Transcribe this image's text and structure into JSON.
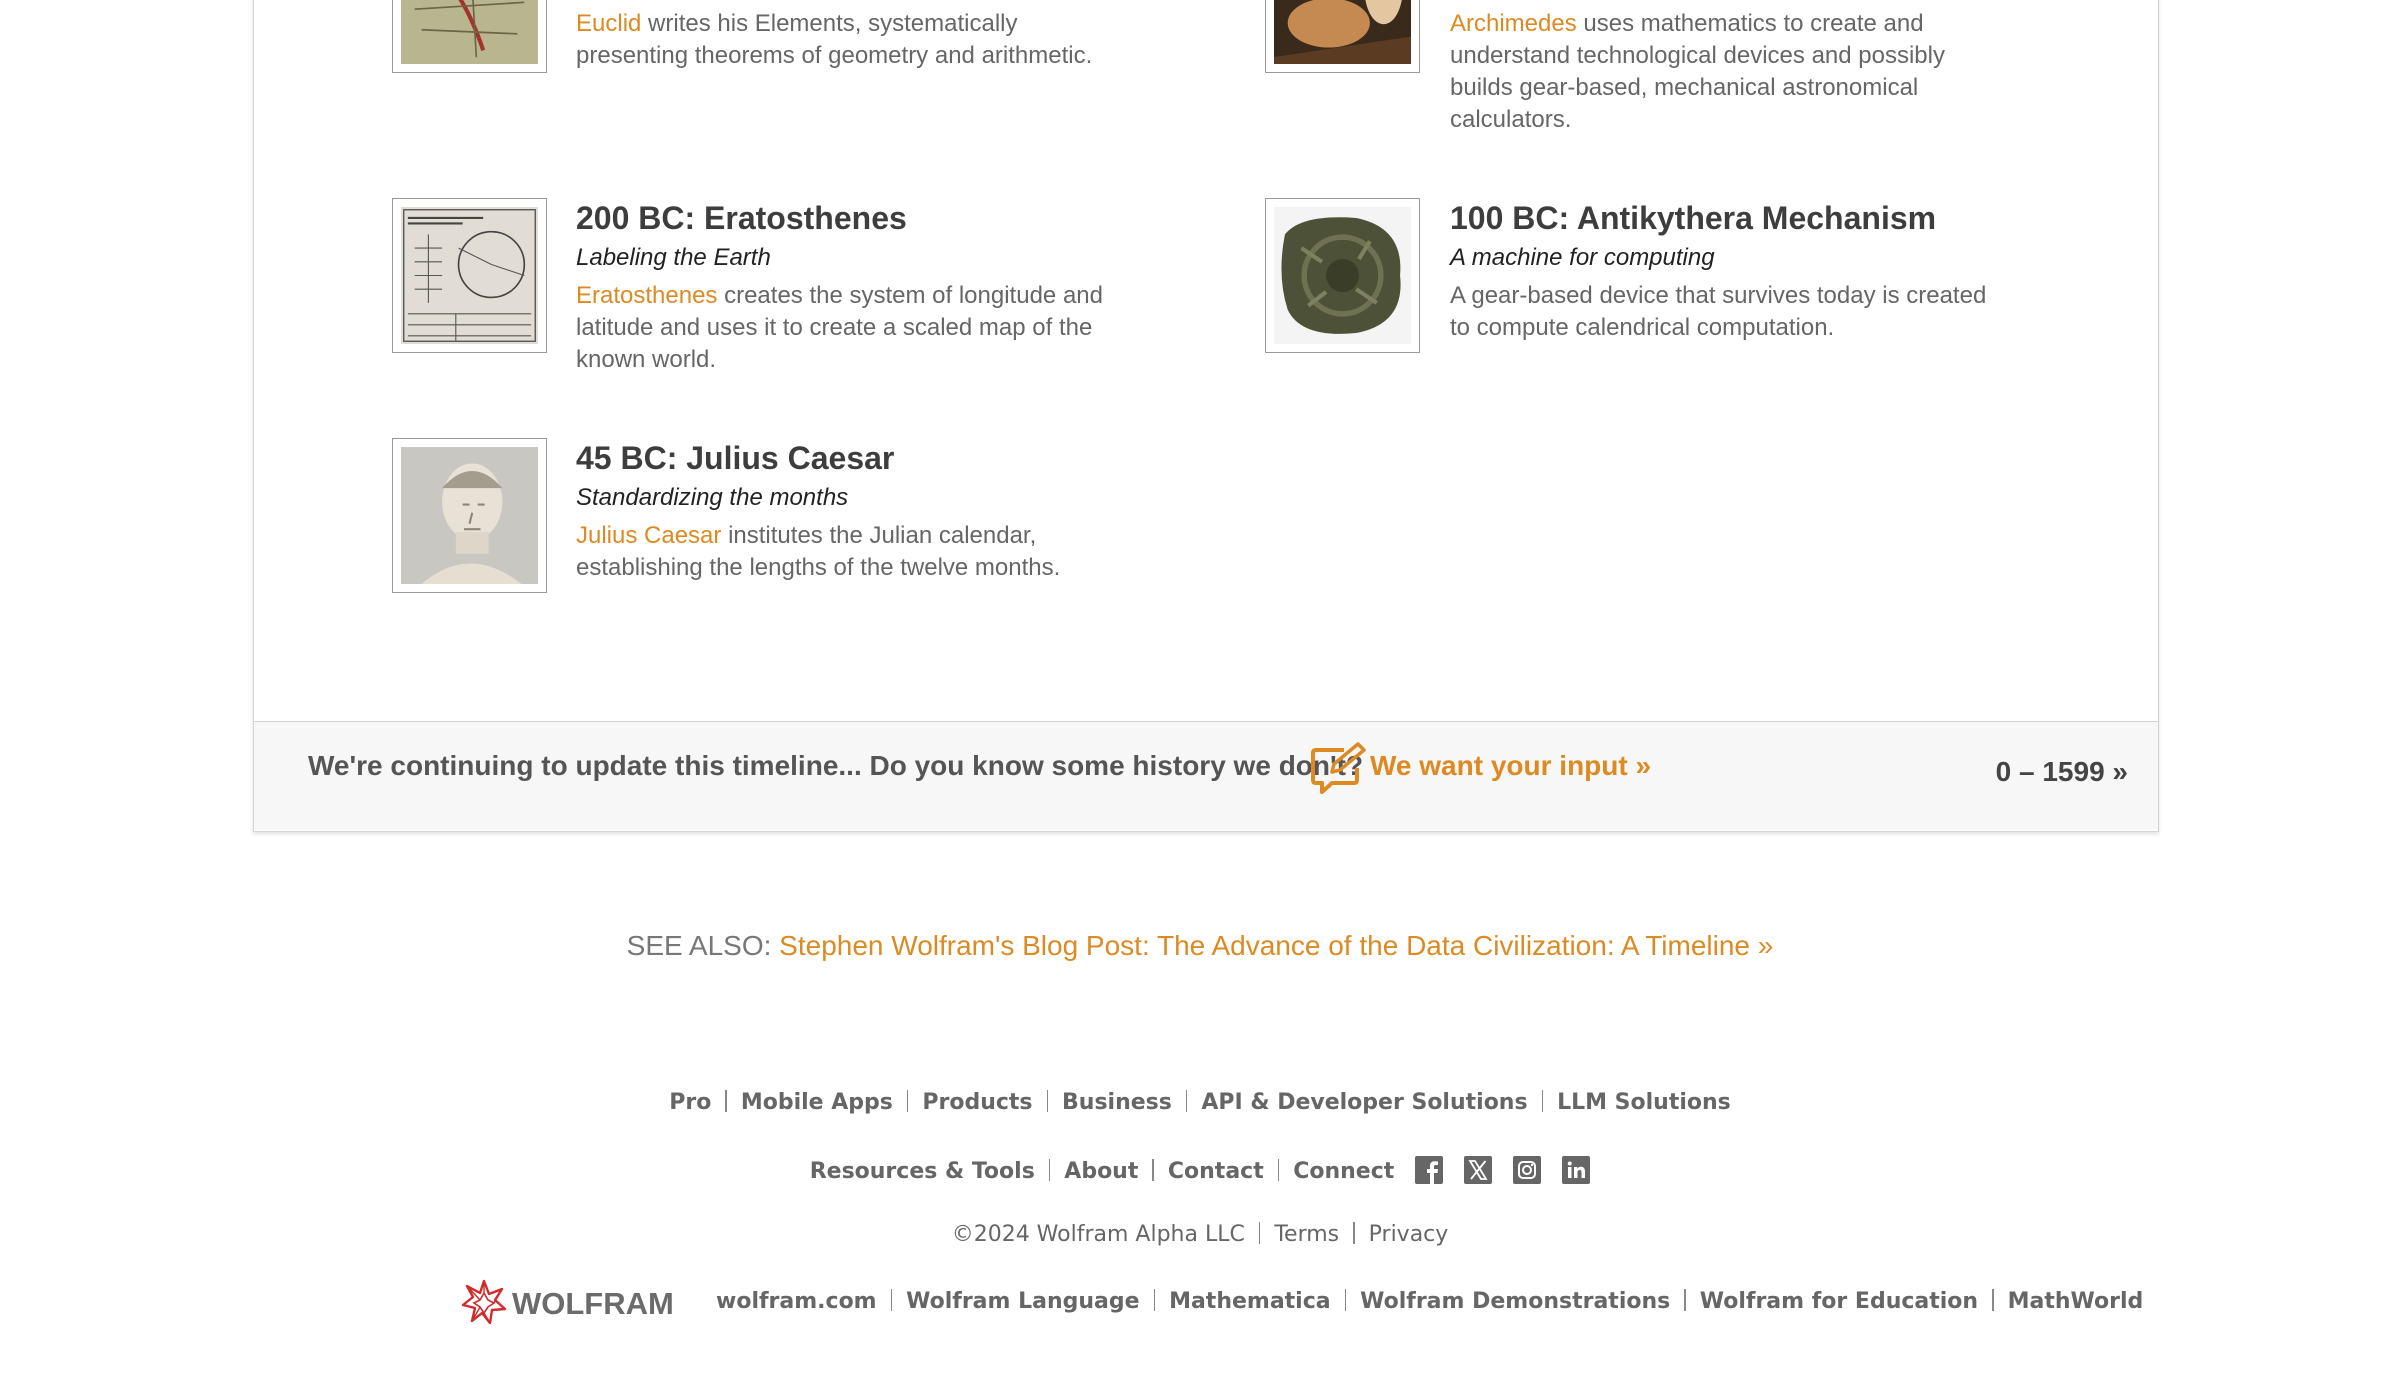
{
  "entries": [
    {
      "id": "euclid",
      "link": "Euclid",
      "desc": " writes his Elements, systematically presenting theorems of geometry and arithmetic.",
      "icon": "euclid-manuscript-icon"
    },
    {
      "id": "archimedes",
      "link": "Archimedes",
      "desc": " uses mathematics to create and understand technological devices and possibly builds gear-based, mechanical astronomical calculators.",
      "icon": "archimedes-painting-icon"
    },
    {
      "id": "eratosthenes",
      "title": "200 BC: Eratosthenes",
      "subtitle": "Labeling the Earth",
      "link": "Eratosthenes",
      "desc": " creates the system of longitude and latitude and uses it to create a scaled map of the known world.",
      "icon": "earth-size-diagram-icon"
    },
    {
      "id": "antikythera",
      "title": "100 BC: Antikythera Mechanism",
      "subtitle": "A machine for computing",
      "desc": "A gear-based device that survives today is created to compute calendrical computation.",
      "icon": "antikythera-mechanism-icon"
    },
    {
      "id": "caesar",
      "title": "45 BC: Julius Caesar",
      "subtitle": "Standardizing the months",
      "link": "Julius Caesar",
      "desc": " institutes the Julian calendar, establishing the lengths of the twelve months.",
      "icon": "caesar-bust-icon"
    }
  ],
  "update_bar": {
    "text": "We're continuing to update this timeline... Do you know some history we don't?",
    "input_link": "We want your input »",
    "range_link": "0 – 1599 »"
  },
  "see_also": {
    "label": "SEE ALSO: ",
    "link": "Stephen Wolfram's Blog Post: The Advance of the Data Civilization: A Timeline »"
  },
  "footer": {
    "row1": [
      "Pro",
      "Mobile Apps",
      "Products",
      "Business",
      "API & Developer Solutions",
      "LLM Solutions"
    ],
    "row2": [
      "Resources & Tools",
      "About",
      "Contact",
      "Connect"
    ],
    "social": [
      "facebook-icon",
      "x-twitter-icon",
      "instagram-icon",
      "linkedin-icon"
    ],
    "copyright": "©2024  Wolfram Alpha LLC",
    "legal": [
      "Terms",
      "Privacy"
    ],
    "logo_text": "WOLFRAM",
    "bottom": [
      "wolfram.com",
      "Wolfram Language",
      "Mathematica",
      "Wolfram Demonstrations",
      "Wolfram for Education",
      "MathWorld"
    ]
  },
  "colors": {
    "accent": "#dd8a22",
    "text_dark": "#3d3d3d",
    "text_body": "#666666",
    "logo_red": "#d12b2b"
  }
}
